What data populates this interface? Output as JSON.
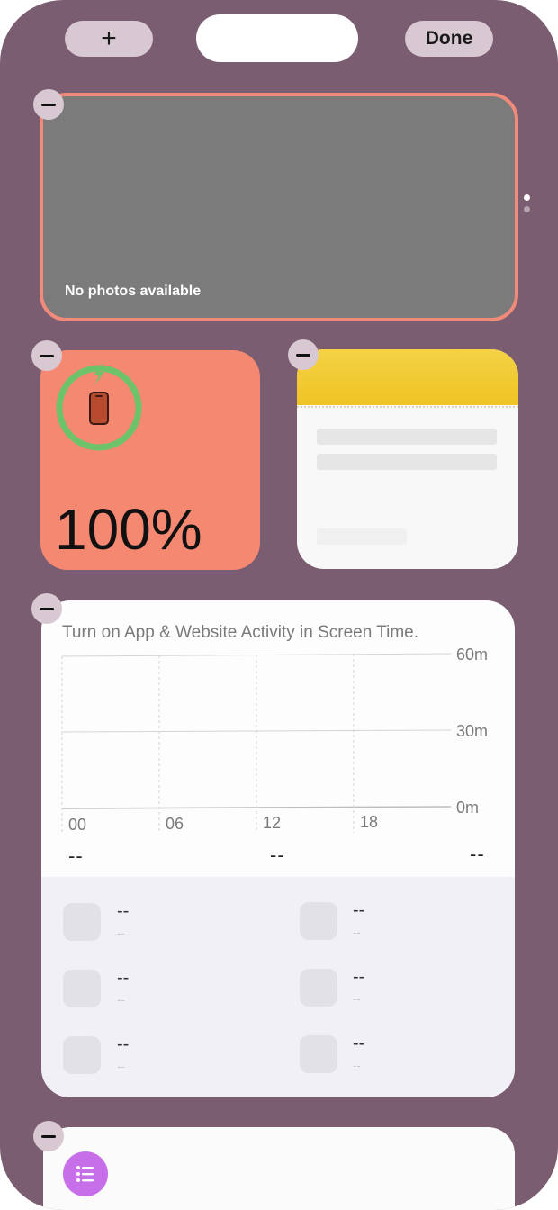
{
  "top_bar": {
    "add_label": "+",
    "done_label": "Done"
  },
  "photos_widget": {
    "message": "No photos available"
  },
  "page_dots": {
    "active_color": "#ffffff",
    "inactive_color": "#b3a4ae"
  },
  "battery_widget": {
    "percent_label": "100%",
    "level": 1.0,
    "ring_color": "#6cc36a",
    "icon": "phone-icon",
    "charging_icon": "bolt-icon"
  },
  "notes_widget": {
    "header_color": "#f3cd35"
  },
  "screen_time_widget": {
    "message": "Turn on App & Website Activity in Screen Time.",
    "chart_data": {
      "type": "bar",
      "x_ticks": [
        "00",
        "06",
        "12",
        "18"
      ],
      "y_ticks": [
        "60m",
        "30m",
        "0m"
      ],
      "ylim": [
        0,
        60
      ],
      "values": []
    },
    "summary": [
      "--",
      "--",
      "--"
    ],
    "apps": [
      {
        "time": "--",
        "sub": "--"
      },
      {
        "time": "--",
        "sub": "--"
      },
      {
        "time": "--",
        "sub": "--"
      },
      {
        "time": "--",
        "sub": "--"
      },
      {
        "time": "--",
        "sub": "--"
      },
      {
        "time": "--",
        "sub": "--"
      }
    ]
  },
  "reminders_widget": {
    "icon": "list-icon",
    "icon_color": "#c76fe8"
  }
}
